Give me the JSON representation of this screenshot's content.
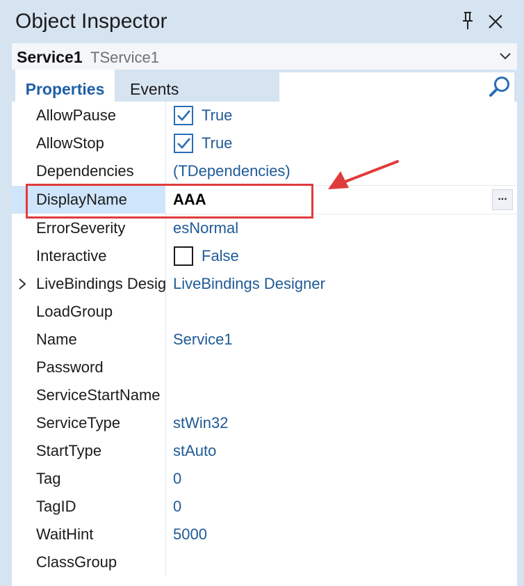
{
  "window": {
    "title": "Object Inspector"
  },
  "component": {
    "name": "Service1",
    "type": "TService1"
  },
  "tabs": {
    "properties": "Properties",
    "events": "Events"
  },
  "search": {
    "placeholder": ""
  },
  "properties": [
    {
      "name": "AllowPause",
      "value": "True",
      "kind": "checkbox",
      "checked": true
    },
    {
      "name": "AllowStop",
      "value": "True",
      "kind": "checkbox",
      "checked": true
    },
    {
      "name": "Dependencies",
      "value": "(TDependencies)",
      "kind": "text"
    },
    {
      "name": "DisplayName",
      "value": "AAA",
      "kind": "edit",
      "selected": true,
      "ellipsis": "..."
    },
    {
      "name": "ErrorSeverity",
      "value": "esNormal",
      "kind": "text"
    },
    {
      "name": "Interactive",
      "value": "False",
      "kind": "checkbox",
      "checked": false
    },
    {
      "name": "LiveBindings Designer",
      "value": "LiveBindings Designer",
      "kind": "expandable"
    },
    {
      "name": "LoadGroup",
      "value": "",
      "kind": "text"
    },
    {
      "name": "Name",
      "value": "Service1",
      "kind": "text"
    },
    {
      "name": "Password",
      "value": "",
      "kind": "text"
    },
    {
      "name": "ServiceStartName",
      "value": "",
      "kind": "text"
    },
    {
      "name": "ServiceType",
      "value": "stWin32",
      "kind": "text"
    },
    {
      "name": "StartType",
      "value": "stAuto",
      "kind": "text"
    },
    {
      "name": "Tag",
      "value": "0",
      "kind": "text"
    },
    {
      "name": "TagID",
      "value": "0",
      "kind": "text"
    },
    {
      "name": "WaitHint",
      "value": "5000",
      "kind": "text"
    },
    {
      "name": "ClassGroup",
      "value": "",
      "kind": "text"
    }
  ],
  "colors": {
    "accent": "#1e5fa8",
    "value_text": "#1f5a96",
    "selected_row": "#cfe5fb",
    "annotation": "#e03b3b",
    "panel_bg": "#d6e3f1"
  }
}
